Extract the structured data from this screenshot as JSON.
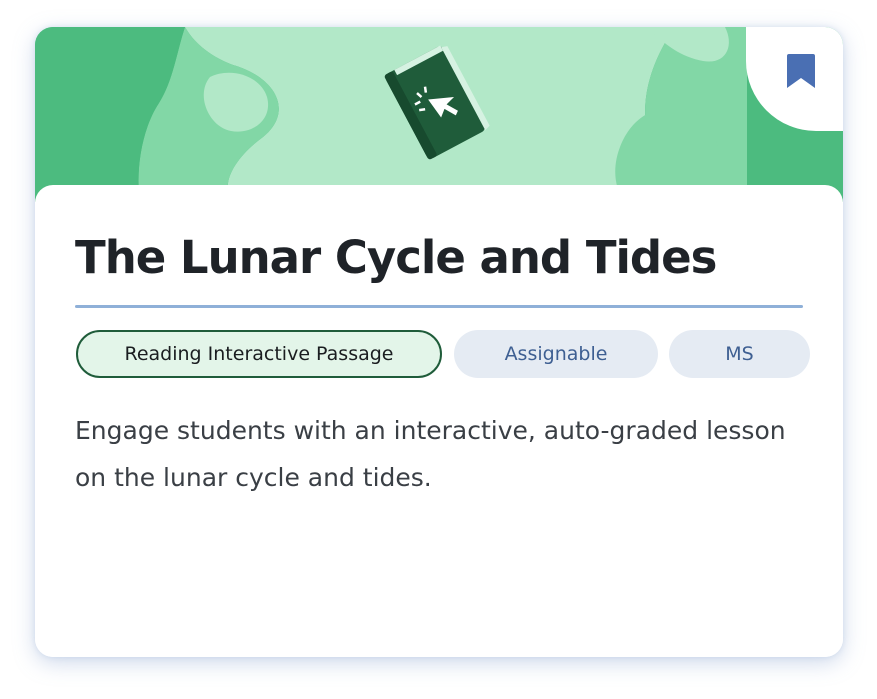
{
  "card": {
    "title": "The Lunar Cycle and Tides",
    "icon": "interactive-book-icon",
    "bookmark_icon": "bookmark-icon",
    "tags": [
      {
        "label": "Reading Interactive Passage"
      },
      {
        "label": "Assignable"
      },
      {
        "label": "MS"
      }
    ],
    "description": "Engage students with an interactive, auto-graded lesson on the lunar cycle and tides."
  },
  "colors": {
    "banner_green": "#4cbb7f",
    "banner_light_green": "#b2e8c8",
    "icon_dark_green": "#1f5c3a",
    "bookmark_blue": "#4a6fb3",
    "divider_blue": "#8fb0d8",
    "tag_primary_bg": "#e3f5e9",
    "tag_secondary_bg": "#e5ebf3",
    "tag_secondary_text": "#3e5f92",
    "title_text": "#1f2328"
  }
}
